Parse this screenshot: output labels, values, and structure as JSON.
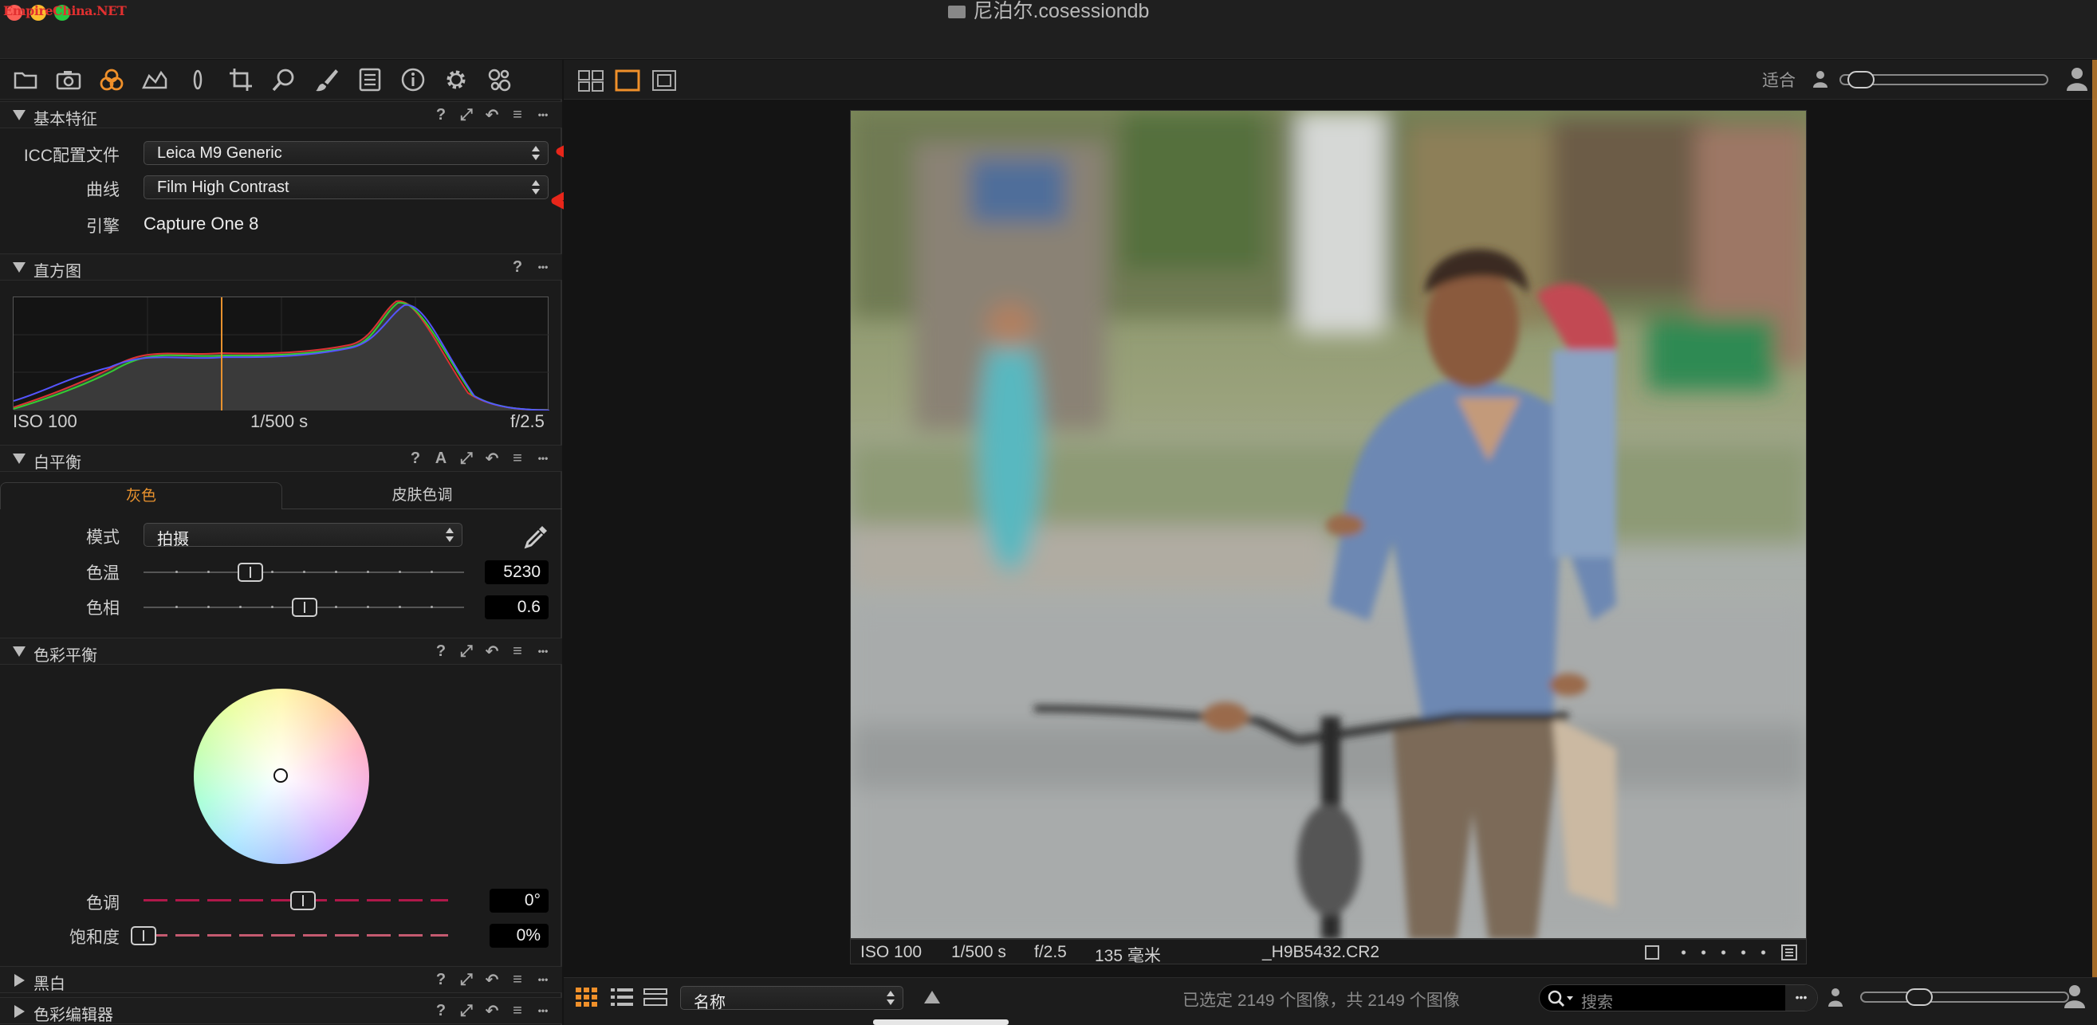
{
  "window": {
    "title": "尼泊尔.cosessiondb",
    "watermark": "EmpireChina.NET"
  },
  "toolbar": {
    "tools": [
      "folder-icon",
      "camera-icon",
      "color-icon",
      "exposure-icon",
      "lens-icon",
      "crop-icon",
      "search-icon",
      "brush-icon",
      "list-icon",
      "info-icon",
      "gear-icon",
      "preset-icon"
    ],
    "active_tool": "color-icon",
    "accent": "#f0902a"
  },
  "basic": {
    "title": "基本特征",
    "icc_label": "ICC配置文件",
    "icc_value": "Leica M9 Generic",
    "curve_label": "曲线",
    "curve_value": "Film High Contrast",
    "engine_label": "引擎",
    "engine_value": "Capture One 8"
  },
  "histogram": {
    "title": "直方图",
    "iso": "ISO 100",
    "shutter": "1/500 s",
    "aperture": "f/2.5"
  },
  "white_balance": {
    "title": "白平衡",
    "tab_gray": "灰色",
    "tab_skin": "皮肤色调",
    "mode_label": "模式",
    "mode_value": "拍摄",
    "temp_label": "色温",
    "temp_value": "5230",
    "tint_label": "色相",
    "tint_value": "0.6"
  },
  "color_balance": {
    "title": "色彩平衡",
    "hue_label": "色调",
    "hue_value": "0°",
    "sat_label": "饱和度",
    "sat_value": "0%"
  },
  "sections_closed": [
    "黑白",
    "色彩编辑器"
  ],
  "viewer": {
    "fit_label": "适合",
    "caption": {
      "iso": "ISO 100",
      "shutter": "1/500 s",
      "aperture": "f/2.5",
      "focal": "135 毫米",
      "filename": "_H9B5432.CR2"
    }
  },
  "browser": {
    "sort_value": "名称",
    "status": "已选定 2149 个图像，共 2149 个图像",
    "search_placeholder": "搜索",
    "search_menu": "•••"
  },
  "header_icon_labels": {
    "help": "?",
    "auto": "A",
    "more": "•••"
  }
}
